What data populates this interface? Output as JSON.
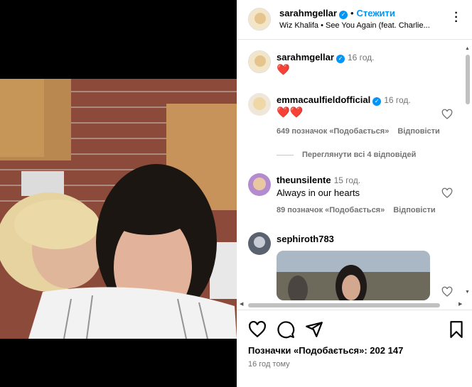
{
  "post": {
    "username": "sarahmgellar",
    "follow_label": "Стежити",
    "music": "Wiz Khalifa • See You Again (feat. Charlie...",
    "more_icon": "more-icon"
  },
  "comments": [
    {
      "username": "sarahmgellar",
      "time": "16 год.",
      "text": "❤️"
    },
    {
      "username": "emmacaulfieldofficial",
      "time": "16 год.",
      "text": "❤️❤️",
      "likes": "649 позначок «Подобається»",
      "reply_label": "Відповісти",
      "view_replies": "Переглянути всі 4 відповідей"
    },
    {
      "username": "theunsilente",
      "time": "15 год.",
      "text": "Always in our hearts",
      "likes": "89 позначок «Подобається»",
      "reply_label": "Відповісти"
    },
    {
      "username": "sephiroth783",
      "time": "",
      "text": ""
    }
  ],
  "actions": {
    "icons": [
      "heart-icon",
      "comment-icon",
      "share-icon",
      "bookmark-icon"
    ],
    "likes_text": "Позначки «Подобається»: 202 147",
    "posted_time": "16 год тому"
  },
  "colors": {
    "accent": "#0095f6",
    "muted": "#737373",
    "heart": "#e0245e"
  }
}
